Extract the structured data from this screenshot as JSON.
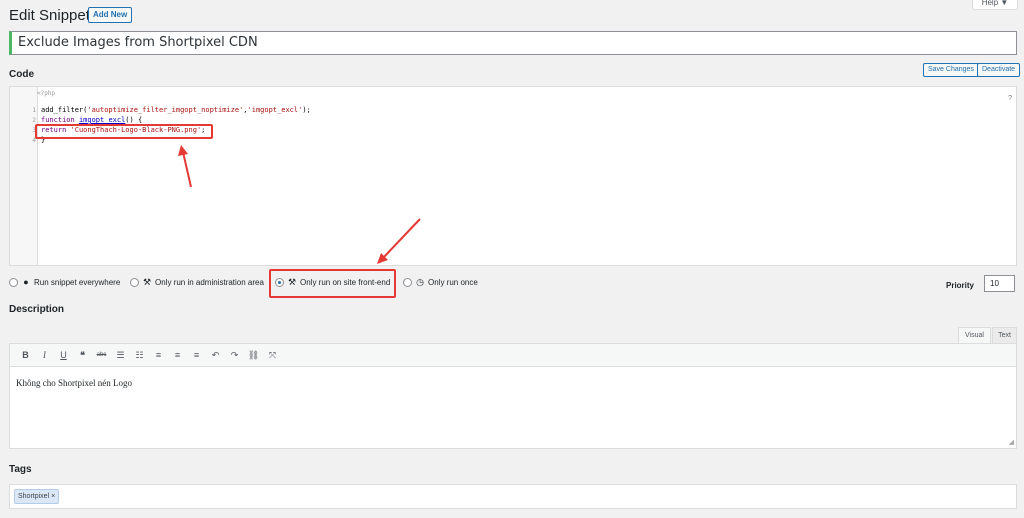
{
  "header": {
    "title": "Edit Snippet",
    "add_new": "Add New",
    "help": "Help ▼"
  },
  "snippet": {
    "title": "Exclude Images from Shortpixel CDN"
  },
  "code": {
    "label": "Code",
    "save_changes": "Save Changes",
    "deactivate": "Deactivate",
    "php_open": "<?php",
    "help_mark": "?",
    "line_numbers": [
      "1",
      "2",
      "3",
      "4"
    ],
    "line1": {
      "fn": "add_filter(",
      "s1": "'autoptimize_filter_imgopt_noptimize'",
      "comma": ",",
      "s2": "'imgopt_excl'",
      "end": ");"
    },
    "line2": {
      "kw": "function",
      "name": "imgopt_excl",
      "parens": "() {"
    },
    "line3": {
      "kw": "return",
      "str": "'CuongThach-Logo-Black-PNG.png'",
      "end": ";"
    },
    "line4": "}"
  },
  "scope": {
    "options": [
      {
        "label": "Run snippet everywhere",
        "icon": "globe-icon",
        "selected": false
      },
      {
        "label": "Only run in administration area",
        "icon": "wrench-icon",
        "selected": false
      },
      {
        "label": "Only run on site front-end",
        "icon": "hammer-icon",
        "selected": true
      },
      {
        "label": "Only run once",
        "icon": "clock-icon",
        "selected": false
      }
    ]
  },
  "priority": {
    "label": "Priority",
    "value": "10"
  },
  "description": {
    "label": "Description",
    "tab_visual": "Visual",
    "tab_text": "Text",
    "toolbar": [
      "bold",
      "italic",
      "underline",
      "blockquote",
      "strikethrough",
      "bullet-list",
      "numbered-list",
      "align-left",
      "align-center",
      "align-right",
      "undo",
      "redo",
      "link",
      "fullscreen"
    ],
    "content": "Không cho Shortpixel nén Logo"
  },
  "tags": {
    "label": "Tags",
    "items": [
      "Shortpixel ×"
    ]
  },
  "colors": {
    "accent": "#2271b1",
    "annotation": "#e53935"
  }
}
